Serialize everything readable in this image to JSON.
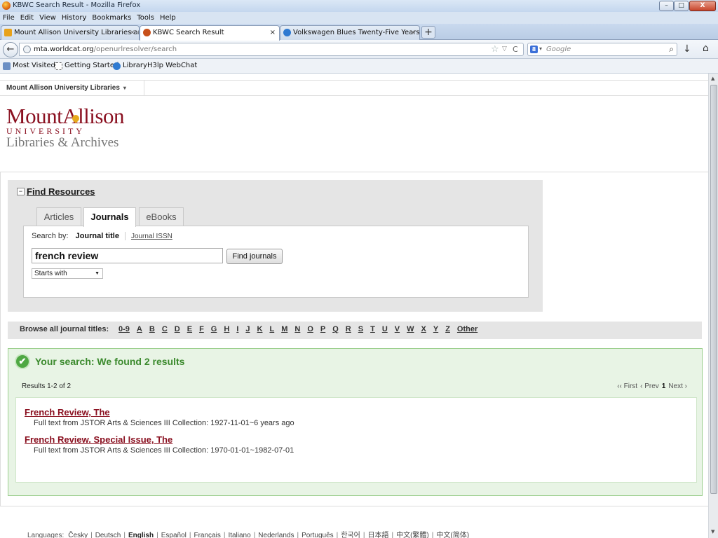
{
  "window": {
    "title": "KBWC Search Result - Mozilla Firefox",
    "minimize": "–",
    "maximize": "□",
    "close": "X"
  },
  "menu": [
    "File",
    "Edit",
    "View",
    "History",
    "Bookmarks",
    "Tools",
    "Help"
  ],
  "tabs": [
    {
      "label": "Mount Allison University Libraries an...",
      "close": "×",
      "icon": "library-icon",
      "color": "#e8a21a"
    },
    {
      "label": "KBWC Search Result",
      "close": "×",
      "icon": "worldcat-icon",
      "color": "#c8501a"
    },
    {
      "label": "Volkswagen Blues Twenty-Five Years ...",
      "close": "×",
      "icon": "page-icon",
      "color": "#2f7ad1"
    }
  ],
  "new_tab": "+",
  "nav": {
    "back": "←",
    "url_host": "mta.worldcat.org",
    "url_path": "/openurlresolver/search",
    "star": "☆",
    "dropdown": "▽",
    "reload": "C",
    "search_engine": "8",
    "search_placeholder": "Google",
    "search_icon": "⌕",
    "download": "↓",
    "home": "⌂"
  },
  "bookmarks": [
    {
      "label": "Most Visited",
      "icon": "bookmark-folder-icon"
    },
    {
      "label": "Getting Started",
      "icon": "dashed-page-icon"
    },
    {
      "label": "LibraryH3lp WebChat",
      "icon": "help-icon"
    }
  ],
  "library_menu": {
    "label": "Mount Allison University Libraries",
    "caret": "▾"
  },
  "logo": {
    "line1": "MountAllison",
    "line2": "UNIVERSITY",
    "line3": "Libraries & Archives"
  },
  "find": {
    "toggle": "–",
    "title": "Find Resources",
    "tabs": [
      "Articles",
      "Journals",
      "eBooks"
    ],
    "active_tab": "Journals",
    "search_by_label": "Search by:",
    "search_by_options": [
      "Journal title",
      "Journal ISSN"
    ],
    "query": "french review",
    "button": "Find journals",
    "match_mode": "Starts with",
    "match_caret": "▼"
  },
  "browse": {
    "label": "Browse all journal titles:",
    "letters": [
      "0-9",
      "A",
      "B",
      "C",
      "D",
      "E",
      "F",
      "G",
      "H",
      "I",
      "J",
      "K",
      "L",
      "M",
      "N",
      "O",
      "P",
      "Q",
      "R",
      "S",
      "T",
      "U",
      "V",
      "W",
      "X",
      "Y",
      "Z",
      "Other"
    ]
  },
  "results": {
    "check": "✔",
    "message": "Your search: We found 2 results",
    "count": "Results 1-2 of 2",
    "pager": {
      "first": "‹‹ First",
      "prev": "‹ Prev",
      "current": "1",
      "next": "Next ›"
    },
    "items": [
      {
        "title": "French Review, The",
        "coverage": "Full text from JSTOR Arts & Sciences III Collection: 1927-11-01~6 years ago"
      },
      {
        "title": "French Review. Special Issue, The",
        "coverage": "Full text from JSTOR Arts & Sciences III Collection: 1970-01-01~1982-07-01"
      }
    ]
  },
  "languages": {
    "label": "Languages:",
    "items": [
      "Česky",
      "Deutsch",
      "English",
      "Español",
      "Français",
      "Italiano",
      "Nederlands",
      "Português",
      "한국어",
      "日本語",
      "中文(繁體)",
      "中文(简体)"
    ],
    "current": "English"
  },
  "colors": {
    "brand": "#8a1020",
    "success": "#3b8a2d"
  }
}
